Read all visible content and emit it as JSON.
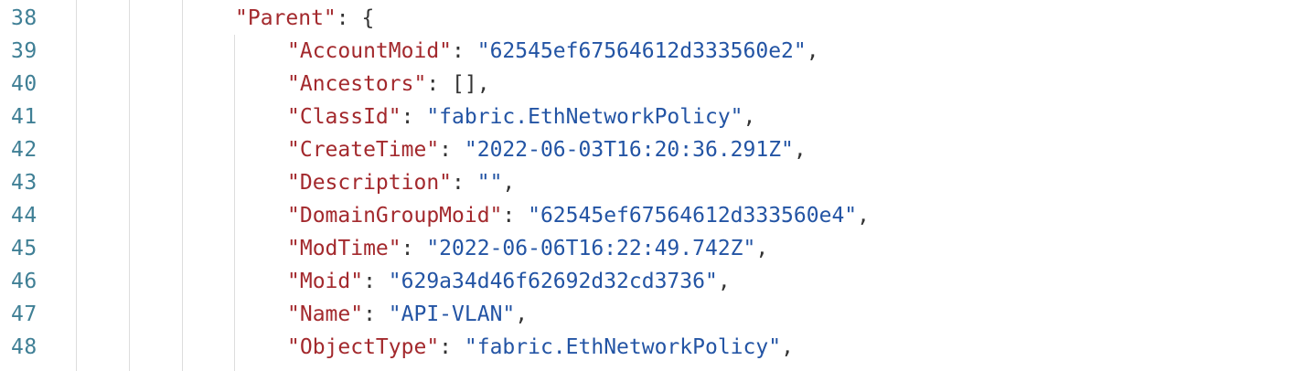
{
  "editor": {
    "lines": [
      {
        "number": "38",
        "key": "\"Parent\"",
        "sep": ": ",
        "value": "",
        "value_type": "punc",
        "open": "{",
        "tail": ""
      },
      {
        "number": "39",
        "key": "\"AccountMoid\"",
        "sep": ": ",
        "value": "\"62545ef67564612d333560e2\"",
        "value_type": "str",
        "open": "",
        "tail": ","
      },
      {
        "number": "40",
        "key": "\"Ancestors\"",
        "sep": ": ",
        "value": "[]",
        "value_type": "punc",
        "open": "",
        "tail": ","
      },
      {
        "number": "41",
        "key": "\"ClassId\"",
        "sep": ": ",
        "value": "\"fabric.EthNetworkPolicy\"",
        "value_type": "str",
        "open": "",
        "tail": ","
      },
      {
        "number": "42",
        "key": "\"CreateTime\"",
        "sep": ": ",
        "value": "\"2022-06-03T16:20:36.291Z\"",
        "value_type": "str",
        "open": "",
        "tail": ","
      },
      {
        "number": "43",
        "key": "\"Description\"",
        "sep": ": ",
        "value": "\"\"",
        "value_type": "str",
        "open": "",
        "tail": ","
      },
      {
        "number": "44",
        "key": "\"DomainGroupMoid\"",
        "sep": ": ",
        "value": "\"62545ef67564612d333560e4\"",
        "value_type": "str",
        "open": "",
        "tail": ","
      },
      {
        "number": "45",
        "key": "\"ModTime\"",
        "sep": ": ",
        "value": "\"2022-06-06T16:22:49.742Z\"",
        "value_type": "str",
        "open": "",
        "tail": ","
      },
      {
        "number": "46",
        "key": "\"Moid\"",
        "sep": ": ",
        "value": "\"629a34d46f62692d32cd3736\"",
        "value_type": "str",
        "open": "",
        "tail": ","
      },
      {
        "number": "47",
        "key": "\"Name\"",
        "sep": ": ",
        "value": "\"API-VLAN\"",
        "value_type": "str",
        "open": "",
        "tail": ","
      },
      {
        "number": "48",
        "key": "\"ObjectType\"",
        "sep": ": ",
        "value": "\"fabric.EthNetworkPolicy\"",
        "value_type": "str",
        "open": "",
        "tail": ","
      }
    ]
  },
  "colors": {
    "background": "#ffffff",
    "line_number": "#3f7f95",
    "key": "#a3292d",
    "string": "#2354a4",
    "punctuation": "#333333",
    "indent_guide": "#dddddd"
  }
}
